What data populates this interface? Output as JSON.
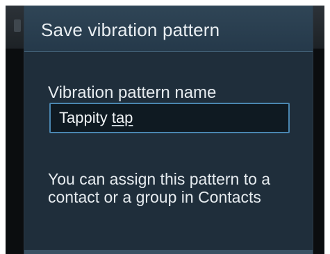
{
  "dialog": {
    "title": "Save vibration pattern",
    "field_label": "Vibration pattern name",
    "input": {
      "value_prefix": "Tappity ",
      "value_underlined": "tap"
    },
    "help_text": "You can assign this pattern to a contact or a group in Contacts"
  },
  "colors": {
    "dialog_background": "#1f2e3b",
    "header_background": "#2f4556",
    "input_border": "#4a86b0",
    "text": "#e6ebef"
  }
}
